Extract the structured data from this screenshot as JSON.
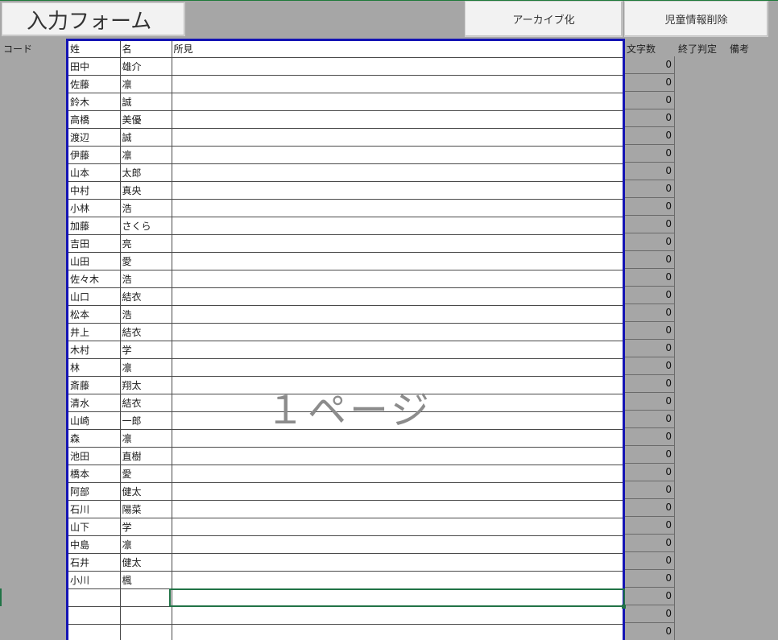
{
  "toolbar": {
    "form_title": "入力フォーム",
    "archive_label": "アーカイブ化",
    "delete_label": "児童情報削除"
  },
  "headers": {
    "code": "コード",
    "last_name": "姓",
    "first_name": "名",
    "observation": "所見",
    "char_count": "文字数",
    "end_judgment": "終了判定",
    "notes": "備考"
  },
  "watermark": "１ページ",
  "students": [
    {
      "last": "田中",
      "first": "雄介",
      "obs": "",
      "count": "0"
    },
    {
      "last": "佐藤",
      "first": "凛",
      "obs": "",
      "count": "0"
    },
    {
      "last": "鈴木",
      "first": "誠",
      "obs": "",
      "count": "0"
    },
    {
      "last": "高橋",
      "first": "美優",
      "obs": "",
      "count": "0"
    },
    {
      "last": "渡辺",
      "first": "誠",
      "obs": "",
      "count": "0"
    },
    {
      "last": "伊藤",
      "first": "凛",
      "obs": "",
      "count": "0"
    },
    {
      "last": "山本",
      "first": "太郎",
      "obs": "",
      "count": "0"
    },
    {
      "last": "中村",
      "first": "真央",
      "obs": "",
      "count": "0"
    },
    {
      "last": "小林",
      "first": "浩",
      "obs": "",
      "count": "0"
    },
    {
      "last": "加藤",
      "first": "さくら",
      "obs": "",
      "count": "0"
    },
    {
      "last": "吉田",
      "first": "亮",
      "obs": "",
      "count": "0"
    },
    {
      "last": "山田",
      "first": "愛",
      "obs": "",
      "count": "0"
    },
    {
      "last": "佐々木",
      "first": "浩",
      "obs": "",
      "count": "0"
    },
    {
      "last": "山口",
      "first": "結衣",
      "obs": "",
      "count": "0"
    },
    {
      "last": "松本",
      "first": "浩",
      "obs": "",
      "count": "0"
    },
    {
      "last": "井上",
      "first": "結衣",
      "obs": "",
      "count": "0"
    },
    {
      "last": "木村",
      "first": "学",
      "obs": "",
      "count": "0"
    },
    {
      "last": "林",
      "first": "凛",
      "obs": "",
      "count": "0"
    },
    {
      "last": "斎藤",
      "first": "翔太",
      "obs": "",
      "count": "0"
    },
    {
      "last": "清水",
      "first": "結衣",
      "obs": "",
      "count": "0"
    },
    {
      "last": "山崎",
      "first": "一郎",
      "obs": "",
      "count": "0"
    },
    {
      "last": "森",
      "first": "凛",
      "obs": "",
      "count": "0"
    },
    {
      "last": "池田",
      "first": "直樹",
      "obs": "",
      "count": "0"
    },
    {
      "last": "橋本",
      "first": "愛",
      "obs": "",
      "count": "0"
    },
    {
      "last": "阿部",
      "first": "健太",
      "obs": "",
      "count": "0"
    },
    {
      "last": "石川",
      "first": "陽菜",
      "obs": "",
      "count": "0"
    },
    {
      "last": "山下",
      "first": "学",
      "obs": "",
      "count": "0"
    },
    {
      "last": "中島",
      "first": "凛",
      "obs": "",
      "count": "0"
    },
    {
      "last": "石井",
      "first": "健太",
      "obs": "",
      "count": "0"
    },
    {
      "last": "小川",
      "first": "楓",
      "obs": "",
      "count": "0"
    },
    {
      "last": "",
      "first": "",
      "obs": "",
      "count": "0"
    },
    {
      "last": "",
      "first": "",
      "obs": "",
      "count": "0"
    },
    {
      "last": "",
      "first": "",
      "obs": "",
      "count": "0"
    }
  ],
  "colors": {
    "sheet_border": "#1414b4",
    "background": "#a6a6a6",
    "selection": "#217346"
  }
}
